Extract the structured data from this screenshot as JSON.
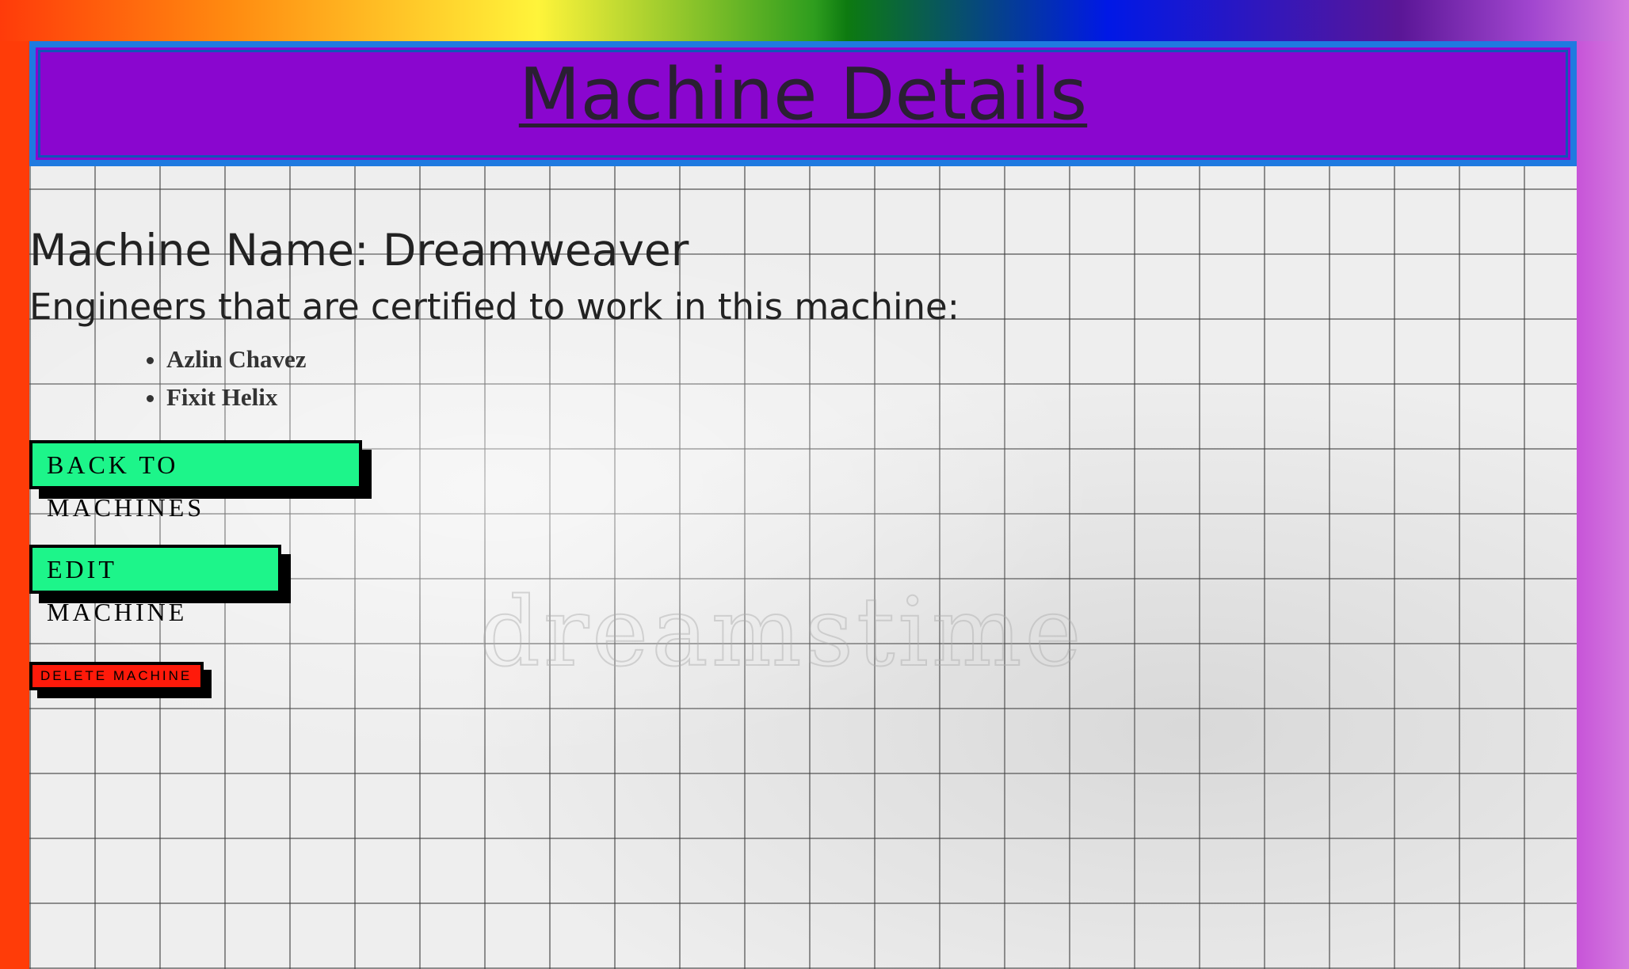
{
  "header": {
    "title": "Machine Details"
  },
  "machine": {
    "name_line": "Machine Name: Dreamweaver",
    "engineers_heading": "Engineers that are certified to work in this machine:",
    "engineers": [
      "Azlin Chavez",
      "Fixit Helix"
    ]
  },
  "actions": {
    "back_label": "BACK TO MACHINES",
    "edit_label": "EDIT MACHINE",
    "delete_label": "DELETE MACHINE"
  },
  "background": {
    "watermark": "dreamstime"
  },
  "colors": {
    "header_bg": "#8a06cf",
    "header_border": "#1f7ae0",
    "primary_button": "#1df58a",
    "danger_button": "#ff1a0a"
  }
}
